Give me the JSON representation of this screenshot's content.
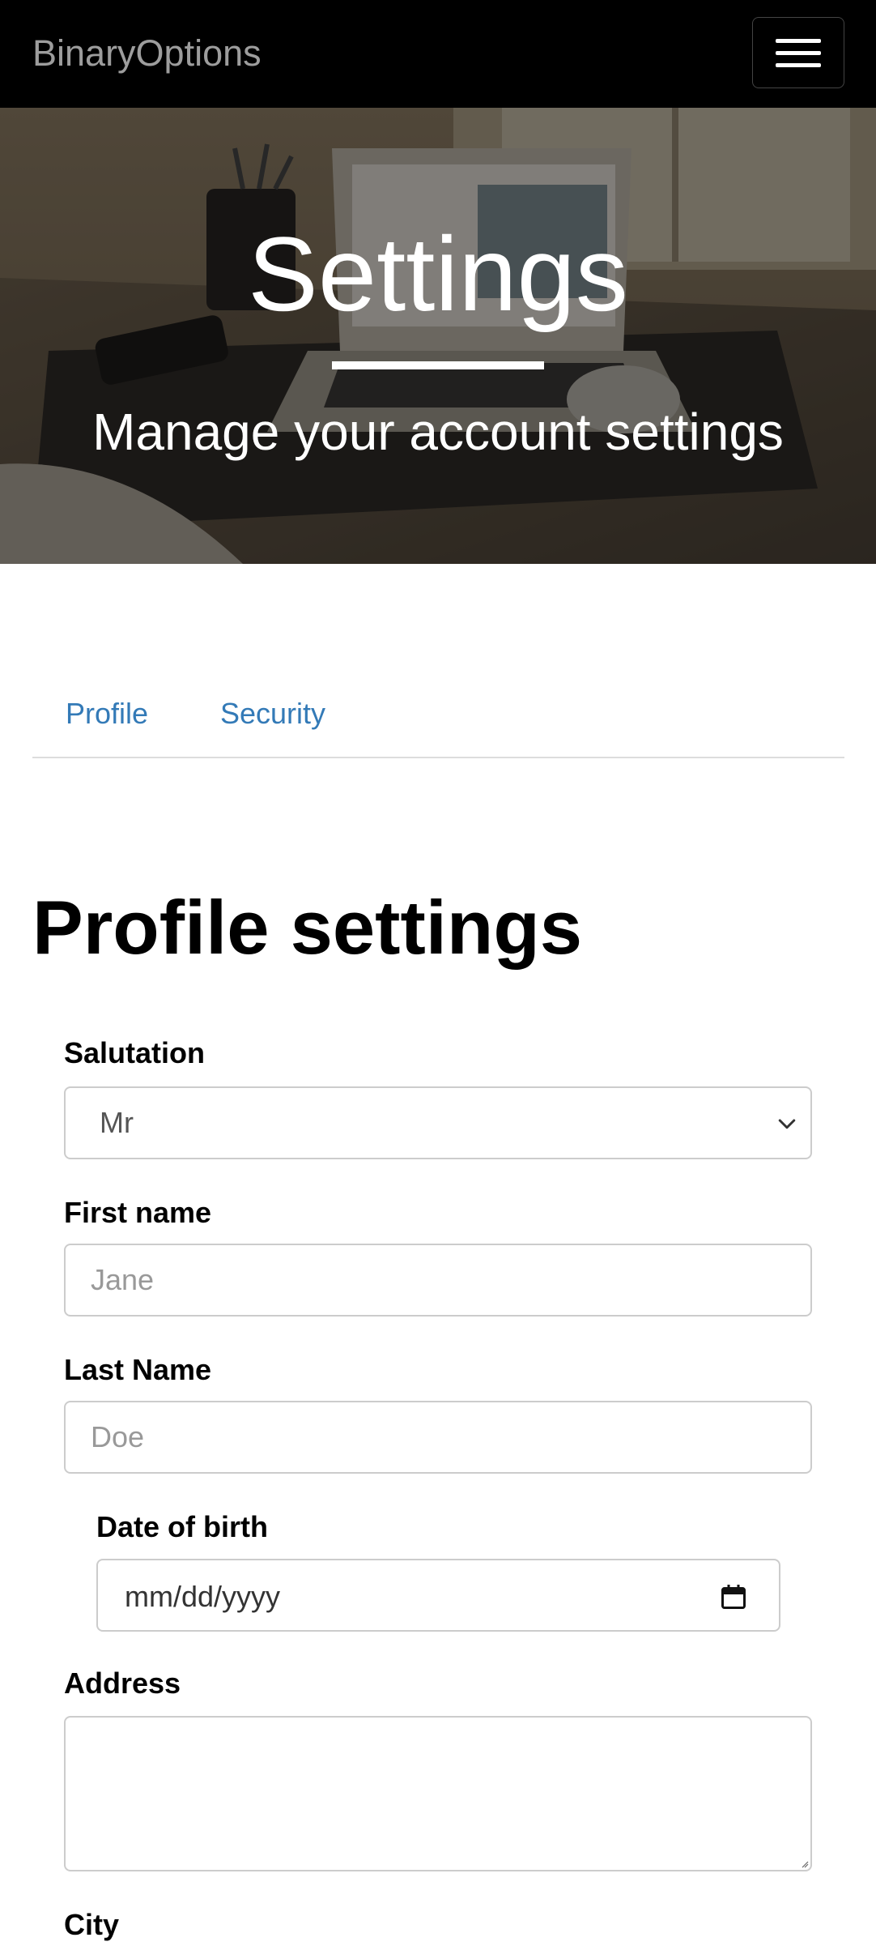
{
  "navbar": {
    "brand": "BinaryOptions",
    "menu_icon": "hamburger-menu-icon"
  },
  "hero": {
    "title": "Settings",
    "subtitle": "Manage your account settings"
  },
  "tabs": [
    {
      "label": "Profile"
    },
    {
      "label": "Security"
    }
  ],
  "profile": {
    "heading": "Profile settings",
    "salutation": {
      "label": "Salutation",
      "value": "Mr"
    },
    "first_name": {
      "label": "First name",
      "placeholder": "Jane"
    },
    "last_name": {
      "label": "Last Name",
      "placeholder": "Doe"
    },
    "date_of_birth": {
      "label": "Date of birth",
      "value": "mm/dd/yyyy"
    },
    "address": {
      "label": "Address",
      "value": ""
    },
    "city": {
      "label": "City"
    }
  },
  "colors": {
    "navbar_bg": "#000000",
    "brand_text": "#9d9d9d",
    "tab_link": "#337ab7",
    "input_border": "#cccccc",
    "placeholder": "#999999"
  }
}
